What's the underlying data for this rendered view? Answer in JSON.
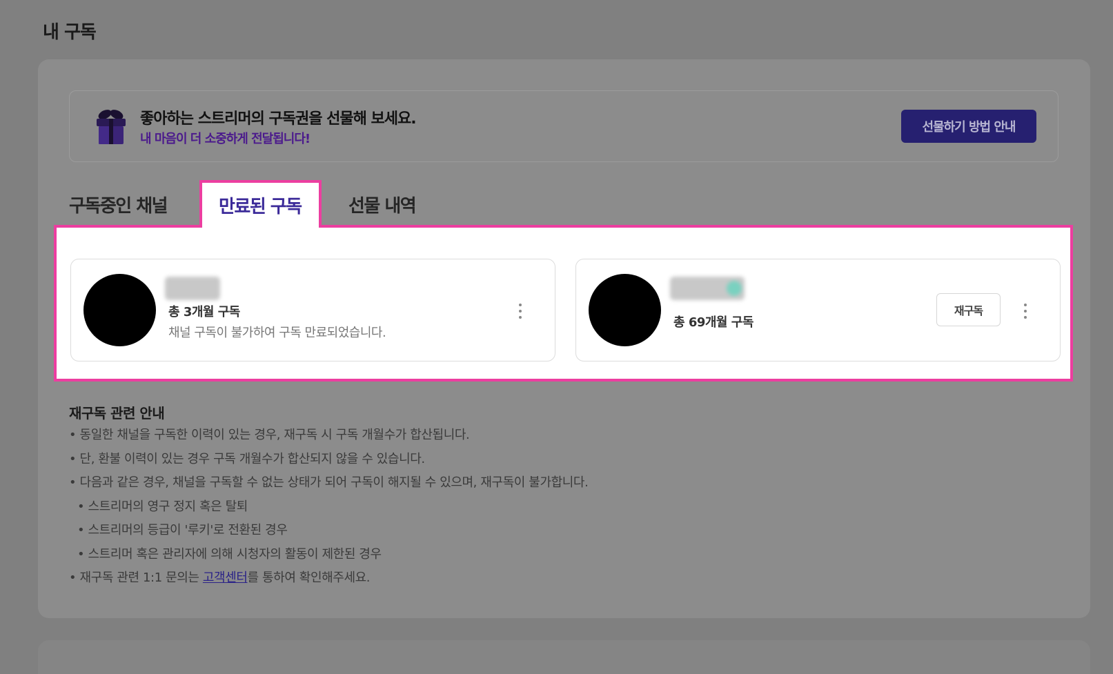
{
  "page": {
    "title": "내 구독"
  },
  "banner": {
    "title": "좋아하는 스트리머의 구독권을 선물해 보세요.",
    "subtitle": "내 마음이 더 소중하게 전달됩니다!",
    "button_label": "선물하기 방법 안내"
  },
  "tabs": [
    {
      "label": "구독중인 채널",
      "active": false
    },
    {
      "label": "만료된 구독",
      "active": true
    },
    {
      "label": "선물 내역",
      "active": false
    }
  ],
  "subscriptions": [
    {
      "total": "총 3개월 구독",
      "description": "채널 구독이 불가하여 구독 만료되었습니다."
    },
    {
      "total": "총 69개월 구독",
      "button_label": "재구독"
    }
  ],
  "guide": {
    "title": "재구독 관련 안내",
    "lines": [
      "• 동일한 채널을 구독한 이력이 있는 경우, 재구독 시 구독 개월수가 합산됩니다.",
      "• 단, 환불 이력이 있는 경우 구독 개월수가 합산되지 않을 수 있습니다.",
      "• 다음과 같은 경우, 채널을 구독할 수 없는 상태가 되어 구독이 해지될 수 있으며, 재구독이 불가합니다.",
      "• 스트리머의 영구 정지 혹은 탈퇴",
      "• 스트리머의 등급이 '루키'로 전환된 경우",
      "• 스트리머 혹은 관리자에 의해 시청자의 활동이 제한된 경우"
    ],
    "last_line_prefix": "• 재구독 관련 1:1 문의는 ",
    "last_line_link": "고객센터",
    "last_line_suffix": "를 통하여 확인해주세요."
  },
  "colors": {
    "accent": "#3b2a99",
    "highlight": "#ec3ea0",
    "button_dark": "#262070"
  },
  "icons": [
    "gift-icon",
    "more-vertical-icon"
  ]
}
